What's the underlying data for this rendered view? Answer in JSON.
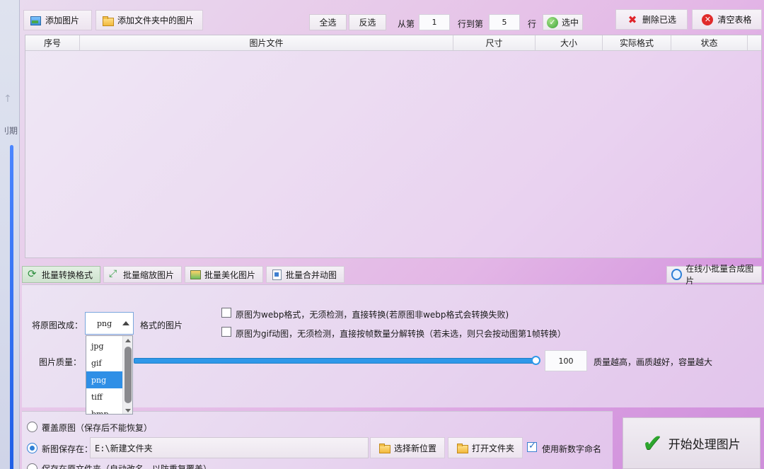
{
  "sidebar": {
    "up_arrow": "↑",
    "cut_text": "刂期"
  },
  "toolbar": {
    "add_image": "添加图片",
    "add_folder_images": "添加文件夹中的图片",
    "select_all": "全选",
    "invert_select": "反选",
    "from_row_label": "从第",
    "from_row_value": "1",
    "to_row_label": "行到第",
    "to_row_value": "5",
    "row_suffix": "行",
    "select": "选中",
    "delete_selected": "删除已选",
    "clear_table": "清空表格"
  },
  "table": {
    "columns": [
      "序号",
      "图片文件",
      "尺寸",
      "大小",
      "实际格式",
      "状态"
    ],
    "rows": []
  },
  "tabs": {
    "items": [
      {
        "label": "批量转换格式",
        "icon": "convert-icon",
        "active": true
      },
      {
        "label": "批量缩放图片",
        "icon": "resize-icon",
        "active": false
      },
      {
        "label": "批量美化图片",
        "icon": "beautify-icon",
        "active": false
      },
      {
        "label": "批量合并动图",
        "icon": "merge-gif-icon",
        "active": false
      }
    ],
    "online_compose": "在线小批量合成图片"
  },
  "convert": {
    "change_to_label": "将原图改成：",
    "format_value": "png",
    "format_suffix": "格式的图片",
    "format_options": [
      "jpg",
      "gif",
      "png",
      "tiff",
      "bmp"
    ],
    "selected_option": "png",
    "webp_option": "原图为webp格式，无须检测，直接转换(若原图非webp格式会转换失败)",
    "gif_option": "原图为gif动图，无须检测，直接按帧数量分解转换（若未选，则只会按动图第1帧转换）",
    "quality_label": "图片质量：",
    "quality_value": "100",
    "quality_fraction": 1.0,
    "quality_hint": "质量越高，画质越好，容量越大"
  },
  "output": {
    "overwrite_label": "覆盖原图（保存后不能恢复）",
    "save_new_label": "新图保存在：",
    "save_path": "E:\\新建文件夹",
    "choose_location": "选择新位置",
    "open_folder": "打开文件夹",
    "use_numeric_name": "使用新数字命名",
    "save_original_label": "保存在原文件夹（自动改名，以防重复覆盖）",
    "start_button": "开始处理图片"
  }
}
